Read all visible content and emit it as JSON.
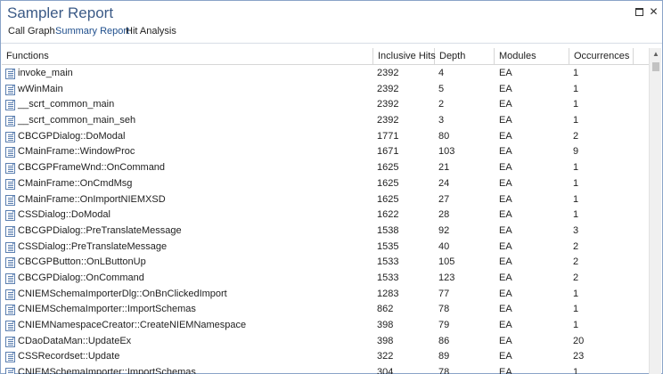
{
  "window": {
    "title": "Sampler Report"
  },
  "tabs": [
    {
      "label": "Call Graph"
    },
    {
      "label": "Summary Report",
      "active": true
    },
    {
      "label": "Hit Analysis"
    }
  ],
  "table": {
    "columns": [
      "Functions",
      "Inclusive Hits",
      "Depth",
      "Modules",
      "Occurrences"
    ],
    "rows": [
      [
        "invoke_main",
        "2392",
        "4",
        "EA",
        "1"
      ],
      [
        "wWinMain",
        "2392",
        "5",
        "EA",
        "1"
      ],
      [
        "__scrt_common_main",
        "2392",
        "2",
        "EA",
        "1"
      ],
      [
        "__scrt_common_main_seh",
        "2392",
        "3",
        "EA",
        "1"
      ],
      [
        "CBCGPDialog::DoModal",
        "1771",
        "80",
        "EA",
        "2"
      ],
      [
        "CMainFrame::WindowProc",
        "1671",
        "103",
        "EA",
        "9"
      ],
      [
        "CBCGPFrameWnd::OnCommand",
        "1625",
        "21",
        "EA",
        "1"
      ],
      [
        "CMainFrame::OnCmdMsg",
        "1625",
        "24",
        "EA",
        "1"
      ],
      [
        "CMainFrame::OnImportNIEMXSD",
        "1625",
        "27",
        "EA",
        "1"
      ],
      [
        "CSSDialog::DoModal",
        "1622",
        "28",
        "EA",
        "1"
      ],
      [
        "CBCGPDialog::PreTranslateMessage",
        "1538",
        "92",
        "EA",
        "3"
      ],
      [
        "CSSDialog::PreTranslateMessage",
        "1535",
        "40",
        "EA",
        "2"
      ],
      [
        "CBCGPButton::OnLButtonUp",
        "1533",
        "105",
        "EA",
        "2"
      ],
      [
        "CBCGPDialog::OnCommand",
        "1533",
        "123",
        "EA",
        "2"
      ],
      [
        "CNIEMSchemaImporterDlg::OnBnClickedImport",
        "1283",
        "77",
        "EA",
        "1"
      ],
      [
        "CNIEMSchemaImporter::ImportSchemas",
        "862",
        "78",
        "EA",
        "1"
      ],
      [
        "CNIEMNamespaceCreator::CreateNIEMNamespace",
        "398",
        "79",
        "EA",
        "1"
      ],
      [
        "CDaoDataMan::UpdateEx",
        "398",
        "86",
        "EA",
        "20"
      ],
      [
        "CSSRecordset::Update",
        "322",
        "89",
        "EA",
        "23"
      ],
      [
        "CNIEMSchemaImporter::ImportSchemas",
        "304",
        "78",
        "EA",
        "1"
      ]
    ]
  },
  "icons": {
    "restore": "restore-window-icon",
    "close": "close-icon",
    "row": "function-document-icon",
    "scroll_up": "scroll-up-arrow-icon"
  },
  "colors": {
    "title": "#3b5a86",
    "active_tab": "#1e4e8c",
    "frame_border": "#8aa4c8"
  }
}
